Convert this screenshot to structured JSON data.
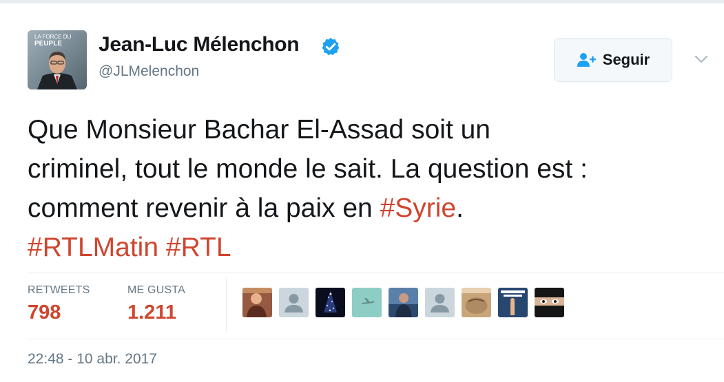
{
  "tweet": {
    "author": {
      "name": "Jean-Luc Mélenchon",
      "handle": "@JLMelenchon",
      "verified": true,
      "avatar_caption_top": "LA FORCE DU",
      "avatar_caption_bottom": "PEUPLE"
    },
    "follow_button": {
      "label": "Seguir",
      "icon": "add-user-icon"
    },
    "menu_icon": "chevron-down-icon",
    "text_lines": [
      {
        "parts": [
          {
            "t": "Que Monsieur Bachar El-Assad soit un",
            "tag": false
          }
        ]
      },
      {
        "parts": [
          {
            "t": "criminel, tout le monde le sait. La question est :",
            "tag": false
          }
        ]
      },
      {
        "parts": [
          {
            "t": "comment revenir à la paix en ",
            "tag": false
          },
          {
            "t": "#Syrie",
            "tag": true
          },
          {
            "t": ".",
            "tag": false
          }
        ]
      },
      {
        "parts": [
          {
            "t": "#RTLMatin",
            "tag": true
          },
          {
            "t": " ",
            "tag": false
          },
          {
            "t": "#RTL",
            "tag": true
          }
        ]
      }
    ],
    "stats": {
      "retweets_label": "RETWEETS",
      "retweets_value": "798",
      "likes_label": "ME GUSTA",
      "likes_value": "1.211"
    },
    "likers": [
      {
        "kind": "photo-person-warm"
      },
      {
        "kind": "default-egg"
      },
      {
        "kind": "photo-christmas-tree"
      },
      {
        "kind": "photo-airplane-sky"
      },
      {
        "kind": "photo-person-blue"
      },
      {
        "kind": "default-egg"
      },
      {
        "kind": "photo-face-closeup"
      },
      {
        "kind": "photo-text-poster"
      },
      {
        "kind": "photo-veiled-eyes"
      }
    ],
    "timestamp": "22:48 - 10 abr. 2017",
    "colors": {
      "accent": "#d0452e",
      "text": "#14171a",
      "muted": "#657786",
      "verified": "#1da1f2",
      "border": "#e6ecf0"
    }
  }
}
